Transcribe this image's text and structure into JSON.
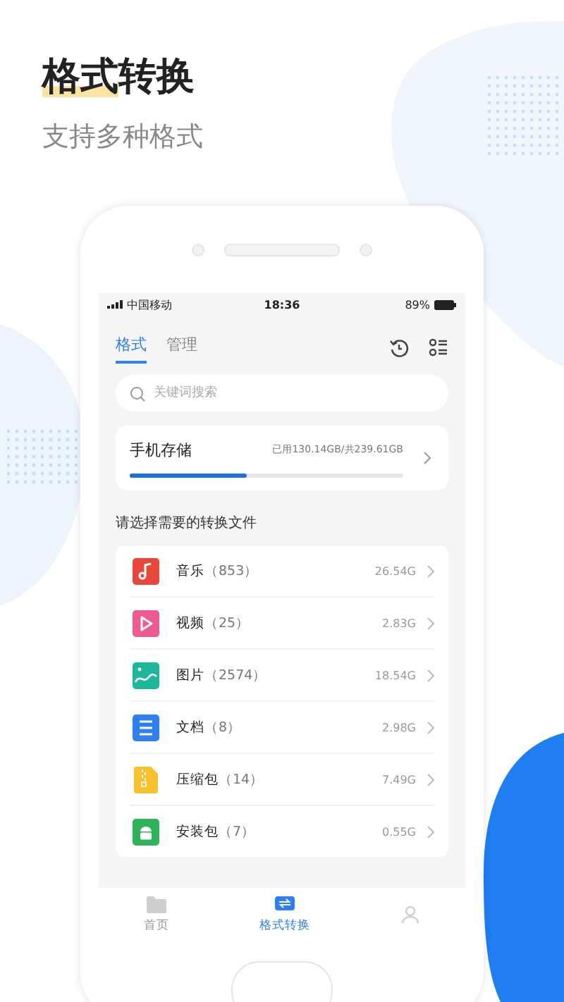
{
  "headline": {
    "title": "格式转换",
    "subtitle": "支持多种格式"
  },
  "status_bar": {
    "carrier": "中国移动",
    "time": "18:36",
    "battery": "89%"
  },
  "tabs": [
    {
      "label": "格式",
      "selected": true
    },
    {
      "label": "管理",
      "selected": false
    }
  ],
  "search": {
    "placeholder": "关键词搜索"
  },
  "storage": {
    "title": "手机存储",
    "usage": "已用130.14GB/共239.61GB",
    "level": 0.43
  },
  "section_title": "请选择需要的转换文件",
  "categories": [
    {
      "kind": "music",
      "color": "#e8483c",
      "name": "音乐",
      "count": "（853）",
      "size": "26.54G"
    },
    {
      "kind": "video",
      "color": "#ee5b90",
      "name": "视频",
      "count": "（25）",
      "size": "2.83G"
    },
    {
      "kind": "image",
      "color": "#1db79b",
      "name": "图片",
      "count": "（2574）",
      "size": "18.54G"
    },
    {
      "kind": "document",
      "color": "#2f80ef",
      "name": "文档",
      "count": "（8）",
      "size": "2.98G"
    },
    {
      "kind": "archive",
      "color": "#f6c12c",
      "name": "压缩包",
      "count": "（14）",
      "size": "7.49G"
    },
    {
      "kind": "app",
      "color": "#2fb25a",
      "name": "安装包",
      "count": "（7）",
      "size": "0.55G"
    }
  ],
  "bottom_nav": [
    {
      "kind": "folder",
      "label": "首页",
      "selected": false
    },
    {
      "kind": "convert",
      "label": "格式转换",
      "selected": true
    },
    {
      "kind": "person",
      "selected": false
    }
  ]
}
